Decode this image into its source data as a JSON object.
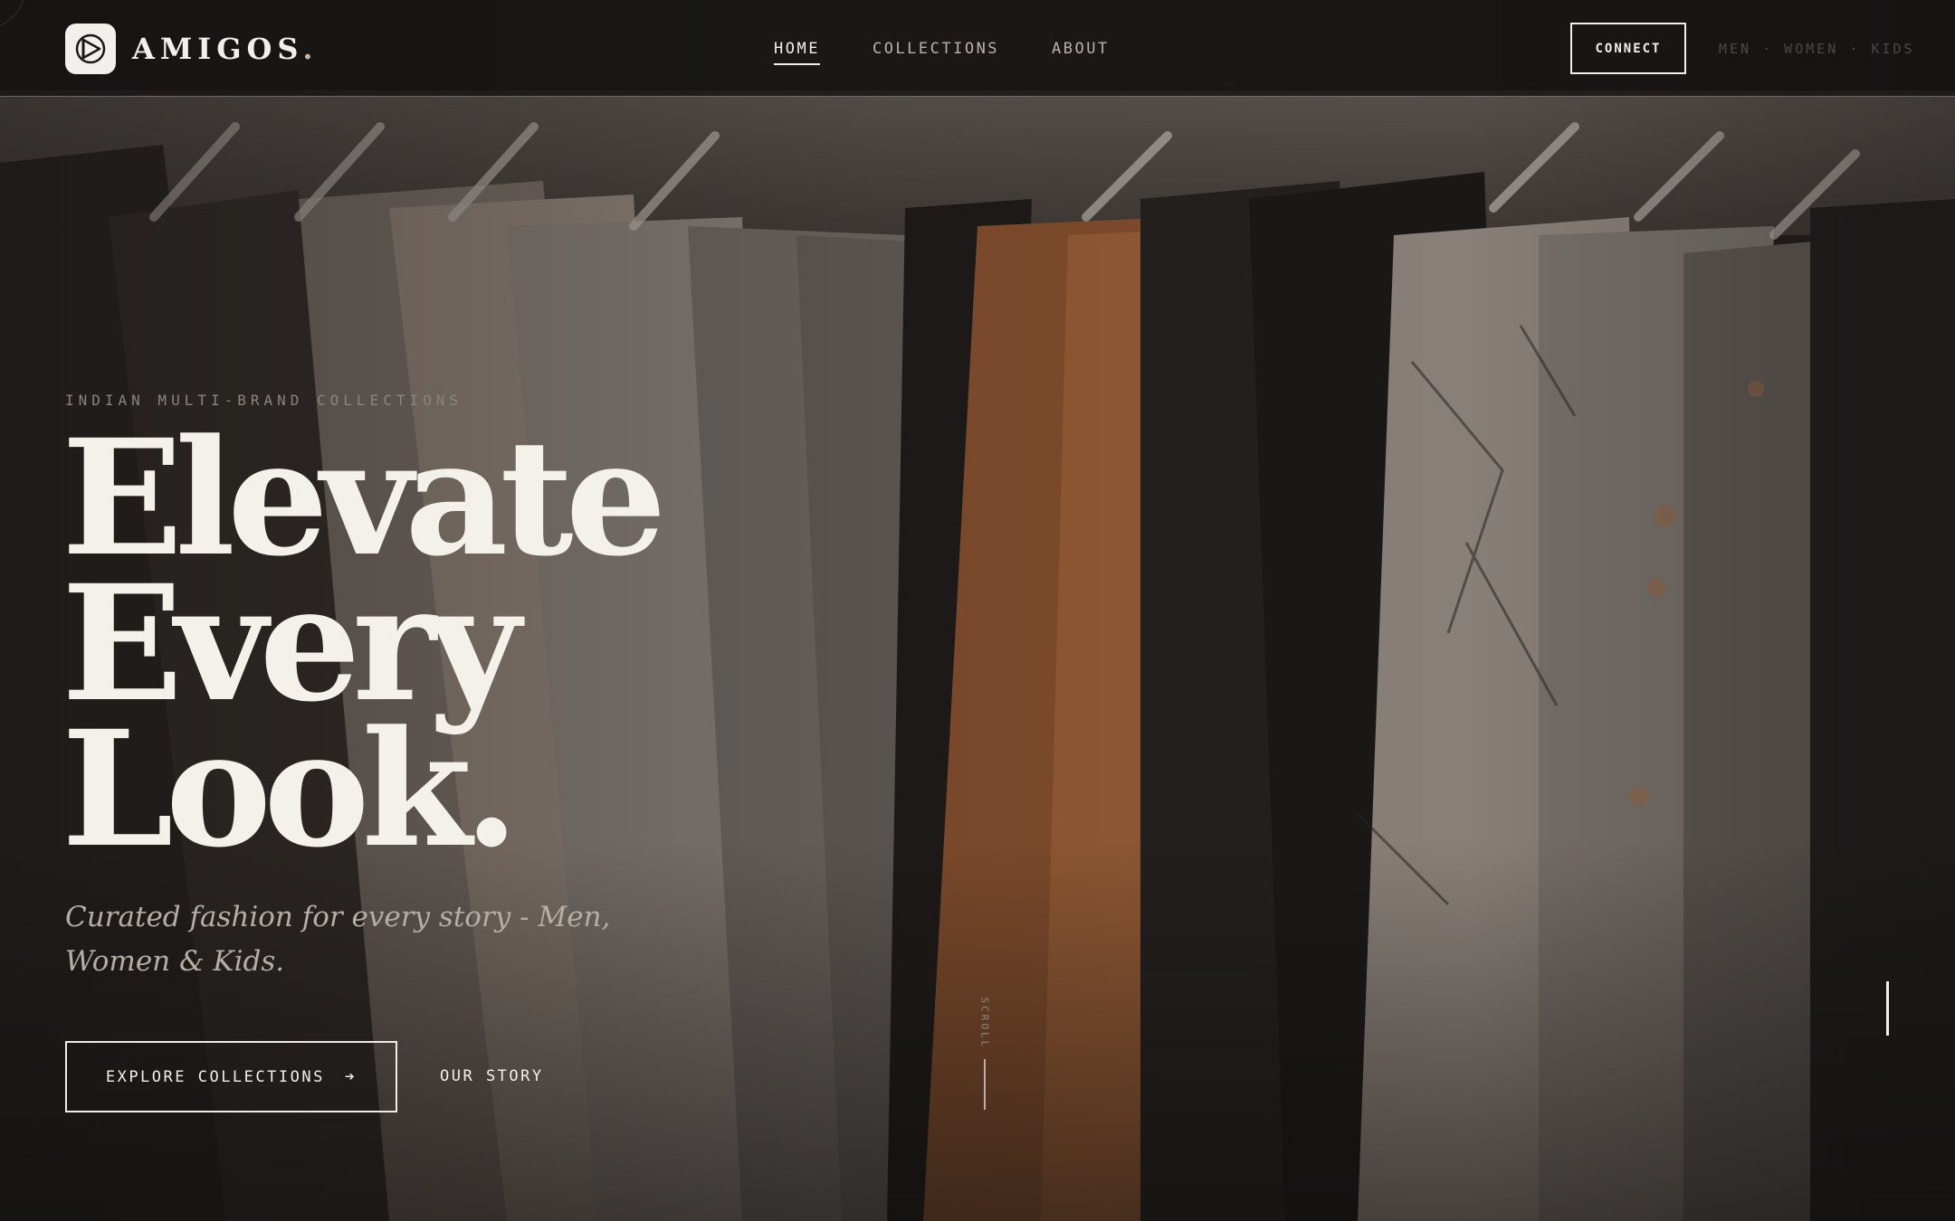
{
  "brand": {
    "name": "AMIGOS",
    "dot": ".",
    "logo_icon": "play-triangle-logo-icon"
  },
  "nav": {
    "items": [
      {
        "label": "HOME",
        "active": true
      },
      {
        "label": "COLLECTIONS",
        "active": false
      },
      {
        "label": "ABOUT",
        "active": false
      }
    ]
  },
  "header": {
    "connect_label": "CONNECT",
    "segments": "MEN · WOMEN · KIDS"
  },
  "hero": {
    "eyebrow": "INDIAN MULTI-BRAND COLLECTIONS",
    "headline": [
      "Elevate",
      "Every",
      "Look."
    ],
    "subtitle": "Curated fashion for every story - Men, Women & Kids.",
    "primary_cta": "EXPLORE COLLECTIONS",
    "primary_cta_icon": "arrow-right-icon",
    "secondary_cta": "OUR STORY",
    "scroll_label": "SCROLL"
  },
  "colors": {
    "text_light": "#f3efea",
    "nav_muted": "#b9b2ab",
    "background_dark": "#1a1716",
    "accent_orange": "#b86d3c"
  }
}
